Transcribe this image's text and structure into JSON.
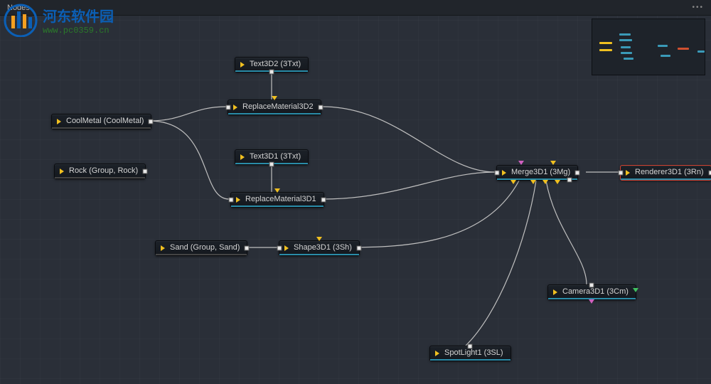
{
  "panel": {
    "title": "Nodes",
    "menu_dots": "•••"
  },
  "watermark": {
    "cn": "河东软件园",
    "url": "www.pc0359.cn"
  },
  "nodes": {
    "text3d2": {
      "label": "Text3D2 (3Txt)"
    },
    "repmat2": {
      "label": "ReplaceMaterial3D2"
    },
    "coolmetal": {
      "label": "CoolMetal (CoolMetal)"
    },
    "text3d1": {
      "label": "Text3D1 (3Txt)"
    },
    "rock": {
      "label": "Rock (Group, Rock)"
    },
    "repmat1": {
      "label": "ReplaceMaterial3D1"
    },
    "merge": {
      "label": "Merge3D1 (3Mg)"
    },
    "renderer": {
      "label": "Renderer3D1 (3Rn)"
    },
    "sand": {
      "label": "Sand (Group, Sand)"
    },
    "shape": {
      "label": "Shape3D1 (3Sh)"
    },
    "camera": {
      "label": "Camera3D1 (3Cm)"
    },
    "spotlight": {
      "label": "SpotLight1 (3SL)"
    }
  }
}
